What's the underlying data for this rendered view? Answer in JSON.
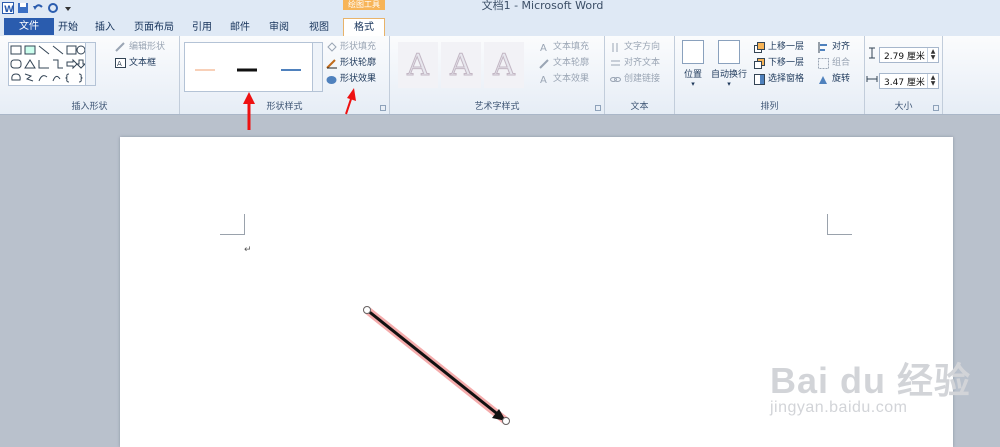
{
  "window": {
    "title": "文档1 - Microsoft Word",
    "context_tab_header": "绘图工具"
  },
  "tabs": [
    "文件",
    "开始",
    "插入",
    "页面布局",
    "引用",
    "邮件",
    "审阅",
    "视图",
    "格式"
  ],
  "active_tab": "格式",
  "groups": {
    "insert_shapes": {
      "label": "插入形状",
      "edit_shape": "编辑形状",
      "text_box": "文本框"
    },
    "shape_styles": {
      "label": "形状样式",
      "fill": "形状填充",
      "outline": "形状轮廓",
      "effects": "形状效果"
    },
    "wordart_styles": {
      "label": "艺术字样式",
      "text_fill": "文本填充",
      "text_outline": "文本轮廓",
      "text_effects": "文本效果",
      "sample_letter": "A"
    },
    "text": {
      "label": "文本",
      "direction": "文字方向",
      "align_text": "对齐文本",
      "create_link": "创建链接"
    },
    "arrange": {
      "label": "排列",
      "position": "位置",
      "wrap_text": "自动换行",
      "bring_forward": "上移一层",
      "send_backward": "下移一层",
      "selection_pane": "选择窗格",
      "align": "对齐",
      "group": "组合",
      "rotate": "旋转"
    },
    "size": {
      "label": "大小",
      "height": "2.79 厘米",
      "width": "3.47 厘米"
    }
  },
  "document": {
    "paragraph_mark": "↵"
  },
  "watermark": {
    "main": "Bai du 经验",
    "sub": "jingyan.baidu.com"
  },
  "colors": {
    "annotation_red": "#ee1111",
    "accent_orange": "#f7b457",
    "file_tab": "#2a5cae"
  }
}
